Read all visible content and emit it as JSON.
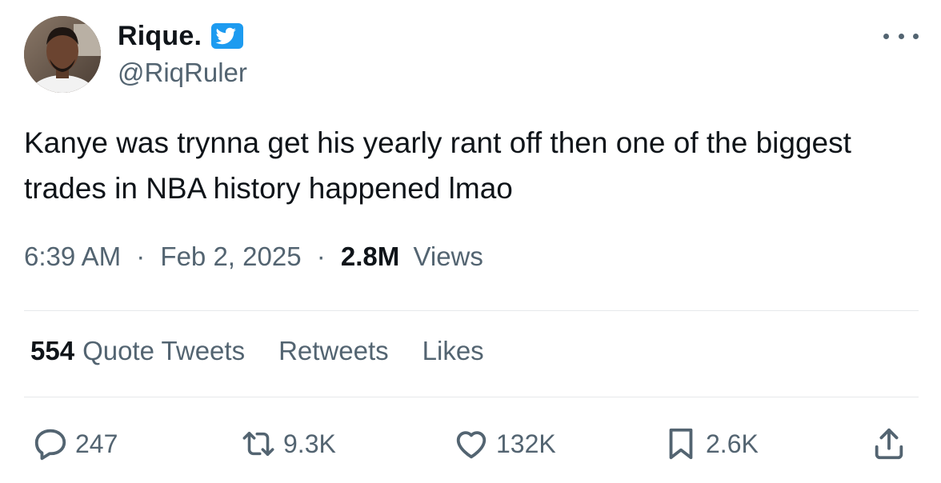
{
  "author": {
    "display_name": "Rique.",
    "handle": "@RiqRuler",
    "verified": true
  },
  "tweet": {
    "text": "Kanye was trynna get his yearly rant off then one of the biggest trades in NBA history happened lmao",
    "time": "6:39 AM",
    "separator": "·",
    "date": "Feb 2, 2025",
    "views_count": "2.8M",
    "views_label": "Views"
  },
  "stats": {
    "quote_tweets_count": "554",
    "quote_tweets_label": "Quote Tweets",
    "retweets_label": "Retweets",
    "likes_label": "Likes"
  },
  "actions": {
    "replies": "247",
    "retweets": "9.3K",
    "likes": "132K",
    "bookmarks": "2.6K"
  },
  "colors": {
    "verified_blue": "#1d9bf0",
    "text_primary": "#0f1419",
    "text_secondary": "#536471",
    "divider": "#e6e9eb"
  },
  "icons": [
    "verified-badge-icon",
    "more-icon",
    "reply-icon",
    "retweet-icon",
    "like-icon",
    "bookmark-icon",
    "share-icon"
  ]
}
